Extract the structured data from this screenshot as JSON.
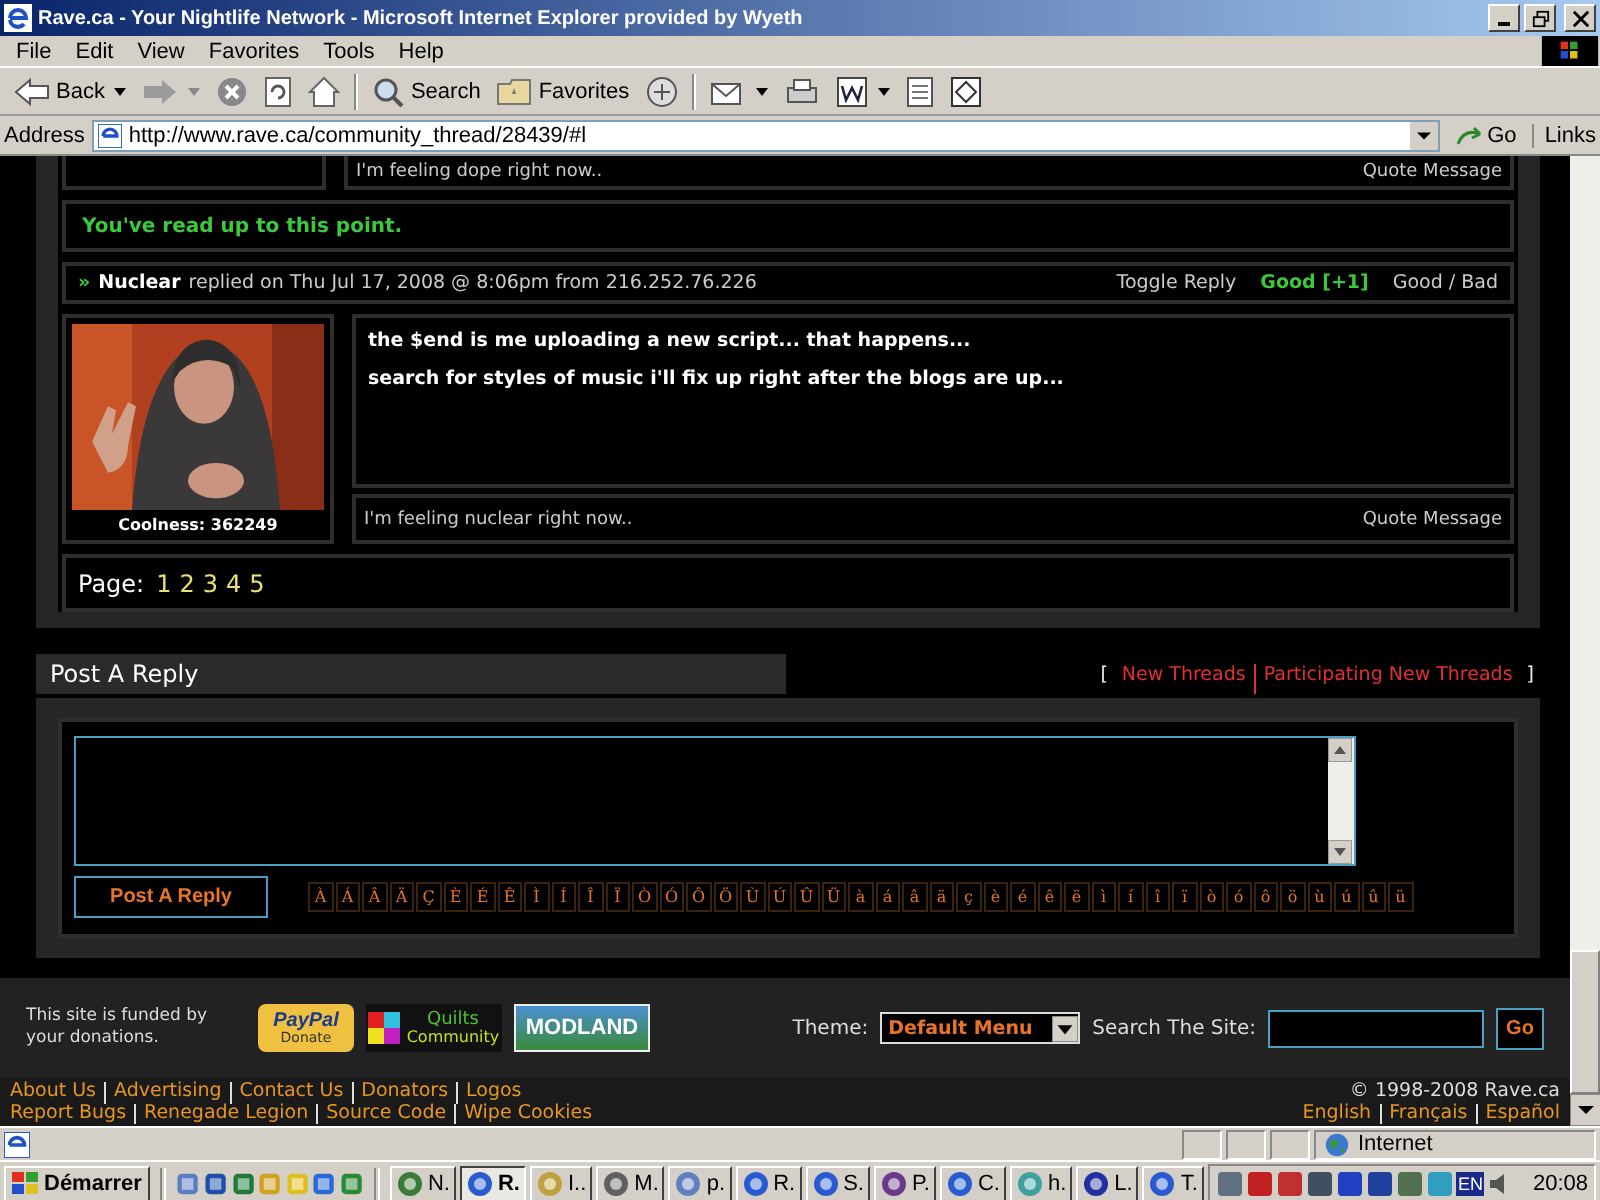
{
  "window": {
    "title": "Rave.ca - Your Nightlife Network - Microsoft Internet Explorer provided by Wyeth"
  },
  "menu": [
    "File",
    "Edit",
    "View",
    "Favorites",
    "Tools",
    "Help"
  ],
  "toolbar": [
    {
      "kind": "back",
      "label": "Back"
    },
    {
      "kind": "forward"
    },
    {
      "kind": "stop"
    },
    {
      "kind": "refresh"
    },
    {
      "kind": "home"
    },
    {
      "kind": "search",
      "label": "Search"
    },
    {
      "kind": "favorites",
      "label": "Favorites"
    },
    {
      "kind": "media"
    },
    {
      "kind": "mail"
    },
    {
      "kind": "print"
    },
    {
      "kind": "edit"
    },
    {
      "kind": "discuss"
    },
    {
      "kind": "messenger"
    }
  ],
  "address": {
    "label": "Address",
    "value": "http://www.rave.ca/community_thread/28439/#l",
    "go": "Go",
    "links": "Links"
  },
  "previous_post": {
    "signature": "I'm feeling dope right now..",
    "quote": "Quote Message"
  },
  "read_marker": "You've read up to this point.",
  "reply": {
    "marker": "»",
    "author": "Nuclear",
    "meta": "replied on Thu Jul 17, 2008 @ 8:06pm from 216.252.76.226",
    "toggle": "Toggle Reply",
    "rating": "Good [+1]",
    "vote": "Good / Bad",
    "coolness": "Coolness: 362249",
    "body": [
      "the $end is me uploading a new script... that happens...",
      "search for styles of music i'll fix up right after the blogs are up..."
    ],
    "signature": "I'm feeling nuclear right now..",
    "quote": "Quote Message"
  },
  "pagination": {
    "label": "Page:",
    "pages": [
      "1",
      "2",
      "3",
      "4",
      "5"
    ]
  },
  "post_reply": {
    "title": "Post A Reply",
    "open": "[",
    "links": [
      "New Threads",
      "Participating New Threads"
    ],
    "close": "]",
    "button": "Post A Reply",
    "characters": [
      "À",
      "Á",
      "Â",
      "Ä",
      "Ç",
      "È",
      "É",
      "Ê",
      "Ì",
      "Í",
      "Î",
      "Ï",
      "Ò",
      "Ó",
      "Ô",
      "Ö",
      "Ù",
      "Ú",
      "Û",
      "Ü",
      "à",
      "á",
      "â",
      "ä",
      "ç",
      "è",
      "é",
      "ê",
      "ë",
      "ì",
      "í",
      "î",
      "ï",
      "ò",
      "ó",
      "ô",
      "ö",
      "ù",
      "ú",
      "û",
      "ü"
    ]
  },
  "footer": {
    "funding": "This site is funded by your donations.",
    "sponsors": [
      {
        "kind": "paypal",
        "label": "PayPal",
        "sublabel": "Donate"
      },
      {
        "kind": "quilts",
        "label": "Quilts",
        "sublabel": "Community"
      },
      {
        "kind": "modland",
        "label": "MODLAND"
      }
    ],
    "theme_label": "Theme:",
    "theme": "Default Menu",
    "search_label": "Search The Site:",
    "search_button": "Go",
    "links": [
      [
        "About Us",
        "Advertising",
        "Contact Us",
        "Donators",
        "Logos"
      ],
      [
        "Report Bugs",
        "Renegade Legion",
        "Source Code",
        "Wipe Cookies"
      ]
    ],
    "copyright": "© 1998-2008 Rave.ca",
    "languages": [
      "English",
      "Français",
      "Español"
    ]
  },
  "status_bar": {
    "zone": "Internet"
  },
  "taskbar": {
    "start": "Démarrer",
    "quick_launch": [
      {
        "kind": "notepad"
      },
      {
        "kind": "word"
      },
      {
        "kind": "excel"
      },
      {
        "kind": "media"
      },
      {
        "kind": "winamp"
      },
      {
        "kind": "ie"
      },
      {
        "kind": "globe"
      }
    ],
    "tasks": [
      {
        "label": "N.",
        "selected": false
      },
      {
        "label": "R.",
        "selected": true
      },
      {
        "label": "I..",
        "selected": false
      },
      {
        "label": "M.",
        "selected": false
      },
      {
        "label": "p.",
        "selected": false
      },
      {
        "label": "R.",
        "selected": false
      },
      {
        "label": "S.",
        "selected": false
      },
      {
        "label": "P.",
        "selected": false
      },
      {
        "label": "C.",
        "selected": false
      },
      {
        "label": "h.",
        "selected": false
      },
      {
        "label": "L.",
        "selected": false
      },
      {
        "label": "T.",
        "selected": false
      }
    ],
    "language": "EN",
    "clock": "20:08"
  }
}
